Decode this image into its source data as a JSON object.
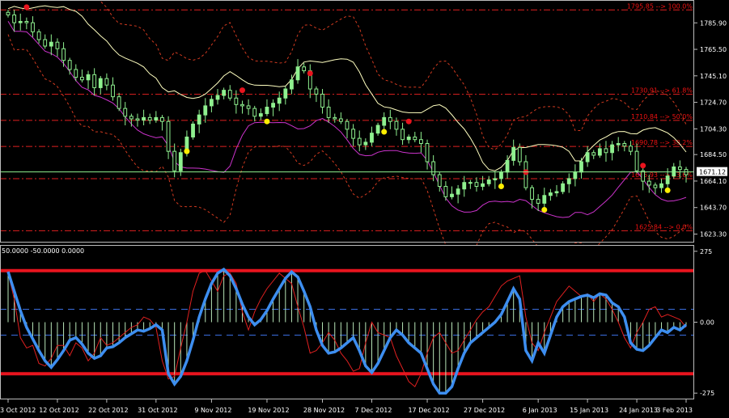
{
  "chart_data": [
    {
      "type": "candlestick",
      "price_axis": {
        "ticks": [
          "1785.90",
          "1765.50",
          "1745.10",
          "1724.70",
          "1704.30",
          "1684.50",
          "1664.10",
          "1643.70",
          "1623.30"
        ],
        "tick_values": [
          1785.9,
          1765.5,
          1745.1,
          1724.7,
          1704.3,
          1684.5,
          1664.1,
          1643.7,
          1623.3
        ],
        "ylim": [
          1618,
          1801
        ]
      },
      "current_price": "1671.12",
      "fib_levels": [
        {
          "label": "1795.85 --> 100.0%",
          "value": 1795.85
        },
        {
          "label": "1730.91 --> 61.8%",
          "value": 1730.91
        },
        {
          "label": "1710.84 --> 50.0%",
          "value": 1710.84
        },
        {
          "label": "1690.78 --> 38.2%",
          "value": 1690.78
        },
        {
          "label": "1665.93 --> 23.6%",
          "value": 1665.93
        },
        {
          "label": "1625.84 --> 0.0%",
          "value": 1625.84
        }
      ],
      "closes": [
        1792,
        1786,
        1787,
        1786,
        1779,
        1773,
        1768,
        1771,
        1766,
        1757,
        1750,
        1744,
        1742,
        1746,
        1736,
        1743,
        1738,
        1729,
        1720,
        1714,
        1712,
        1711,
        1713,
        1711,
        1713,
        1710,
        1687,
        1672,
        1686,
        1698,
        1708,
        1715,
        1722,
        1727,
        1730,
        1734,
        1728,
        1723,
        1722,
        1720,
        1714,
        1716,
        1721,
        1724,
        1728,
        1735,
        1742,
        1752,
        1749,
        1735,
        1731,
        1721,
        1713,
        1712,
        1710,
        1704,
        1697,
        1692,
        1694,
        1701,
        1707,
        1713,
        1710,
        1704,
        1696,
        1698,
        1696,
        1693,
        1679,
        1669,
        1660,
        1652,
        1654,
        1658,
        1663,
        1663,
        1660,
        1662,
        1665,
        1666,
        1671,
        1680,
        1690,
        1679,
        1659,
        1650,
        1647,
        1653,
        1655,
        1656,
        1662,
        1666,
        1671,
        1679,
        1686,
        1684,
        1689,
        1686,
        1692,
        1693,
        1691,
        1687,
        1672,
        1664,
        1661,
        1659,
        1662,
        1668,
        1675,
        1673,
        1669
      ],
      "dates": [
        "3 Oct 2012",
        "12 Oct 2012",
        "22 Oct 2012",
        "31 Oct 2012",
        "9 Nov 2012",
        "19 Nov 2012",
        "28 Nov 2012",
        "7 Dec 2012",
        "17 Dec 2012",
        "27 Dec 2012",
        "6 Jan 2013",
        "15 Jan 2013",
        "24 Jan 2013",
        "3 Feb 2013"
      ],
      "date_indices": [
        0,
        8,
        16,
        24,
        33,
        42,
        51,
        59,
        68,
        77,
        86,
        94,
        102,
        110
      ],
      "red_dots": [
        3,
        38,
        49,
        65,
        84,
        103
      ],
      "yellow_dots": [
        29,
        42,
        61,
        80,
        87,
        107
      ],
      "colors": {
        "candle": "#8ff08f",
        "upper_band": "#ffffc0",
        "lower_band": "#cc33cc",
        "envelope": "#d23a20",
        "fib": "#e02020",
        "current_line": "#8ef08e"
      }
    },
    {
      "type": "oscillator",
      "header": "50.0000 -50.0000 0.0000",
      "axis_ticks": [
        "275",
        "0.00",
        "-275"
      ],
      "tick_values": [
        275,
        0,
        -275
      ],
      "ylim": [
        -290,
        290
      ],
      "levels": [
        200,
        0,
        -200
      ],
      "dashed_levels": [
        50,
        -50
      ],
      "main_series": [
        196,
        120,
        45,
        -20,
        -65,
        -110,
        -150,
        -175,
        -145,
        -110,
        -70,
        -60,
        -85,
        -120,
        -140,
        -130,
        -100,
        -95,
        -80,
        -60,
        -45,
        -30,
        -35,
        -25,
        -10,
        -30,
        -200,
        -240,
        -210,
        -150,
        -70,
        20,
        90,
        150,
        190,
        205,
        180,
        130,
        70,
        20,
        -10,
        10,
        45,
        90,
        130,
        170,
        195,
        175,
        120,
        60,
        -30,
        -90,
        -120,
        -115,
        -100,
        -80,
        -60,
        -110,
        -170,
        -195,
        -160,
        -110,
        -60,
        -30,
        -50,
        -80,
        -100,
        -120,
        -180,
        -240,
        -275,
        -275,
        -250,
        -180,
        -120,
        -80,
        -60,
        -40,
        -20,
        0,
        30,
        80,
        130,
        90,
        -110,
        -150,
        -80,
        -120,
        -50,
        20,
        60,
        80,
        90,
        100,
        105,
        95,
        110,
        105,
        75,
        60,
        20,
        -80,
        -105,
        -110,
        -90,
        -60,
        -30,
        -40,
        -20,
        -30,
        -10
      ],
      "signal_series": [
        190,
        90,
        -60,
        -100,
        -90,
        -160,
        -170,
        -140,
        -90,
        -90,
        -130,
        -80,
        -100,
        -150,
        -120,
        -60,
        -90,
        -80,
        -60,
        -40,
        -20,
        -10,
        20,
        10,
        -20,
        -150,
        -220,
        -210,
        -100,
        0,
        120,
        190,
        200,
        160,
        120,
        180,
        190,
        150,
        40,
        -30,
        40,
        90,
        130,
        160,
        190,
        170,
        150,
        60,
        -20,
        -120,
        -110,
        -80,
        -40,
        -70,
        -120,
        -150,
        -190,
        -180,
        -80,
        0,
        -40,
        -50,
        -60,
        -130,
        -180,
        -230,
        -250,
        -200,
        -120,
        -60,
        -40,
        -80,
        -120,
        -110,
        -70,
        -30,
        10,
        40,
        60,
        100,
        140,
        160,
        170,
        180,
        20,
        -80,
        -110,
        -40,
        20,
        80,
        110,
        140,
        120,
        100,
        110,
        80,
        110,
        90,
        50,
        0,
        -60,
        -100,
        -40,
        0,
        50,
        60,
        20,
        30,
        20,
        10,
        -20
      ]
    }
  ]
}
